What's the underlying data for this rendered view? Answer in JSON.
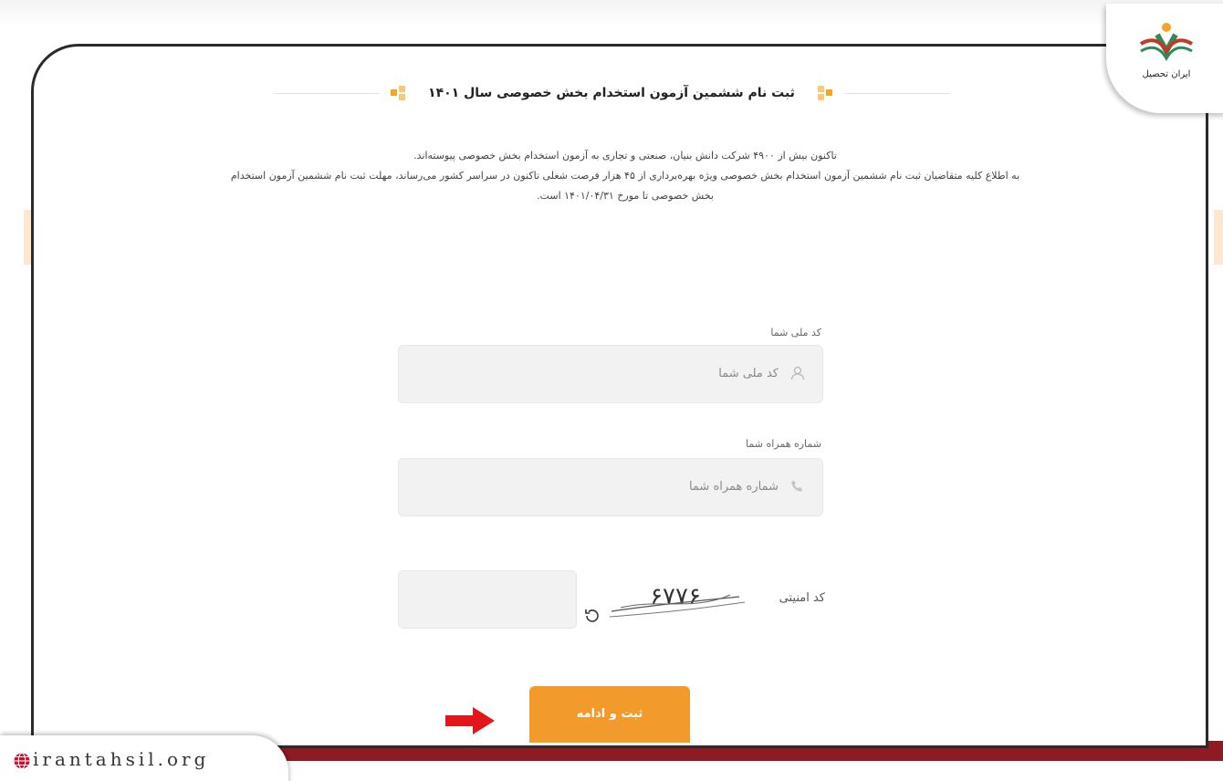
{
  "header": {
    "title": "ثبت نام ششمین آزمون استخدام بخش خصوصی سال ۱۴۰۱"
  },
  "description": {
    "line1": "تاکنون بیش از ۴۹۰۰ شرکت دانش بنیان، صنعتی و تجاری به آزمون استخدام بخش خصوصی پیوسته‌اند.",
    "line2": "به اطلاع کلیه متقاضیان ثبت نام ششمین آزمون استخدام بخش خصوصی ویژه بهره‌برداری از ۴۵ هزار فرصت شغلی تاکنون در سراسر کشور می‌رساند، مهلت ثبت نام ششمین آزمون استخدام",
    "line3": "بخش خصوصی تا مورخ ۱۴۰۱/۰۴/۳۱ است."
  },
  "form": {
    "national_code": {
      "label": "کد ملی شما",
      "placeholder": "کد ملی شما",
      "icon": "user-icon"
    },
    "mobile": {
      "label": "شماره همراه شما",
      "placeholder": "شماره همراه شما",
      "icon": "phone-icon"
    },
    "captcha": {
      "label": "کد امنیتی",
      "image_text": "۶۷۷۶",
      "refresh_icon": "refresh-icon"
    },
    "submit_label": "ثبت و ادامه"
  },
  "branding": {
    "logo_text": "ایران تحصیل",
    "website": "irantahsil.org"
  },
  "colors": {
    "accent": "#f39a2c",
    "brand_red": "#8e1b24",
    "arrow_red": "#e3161b"
  }
}
